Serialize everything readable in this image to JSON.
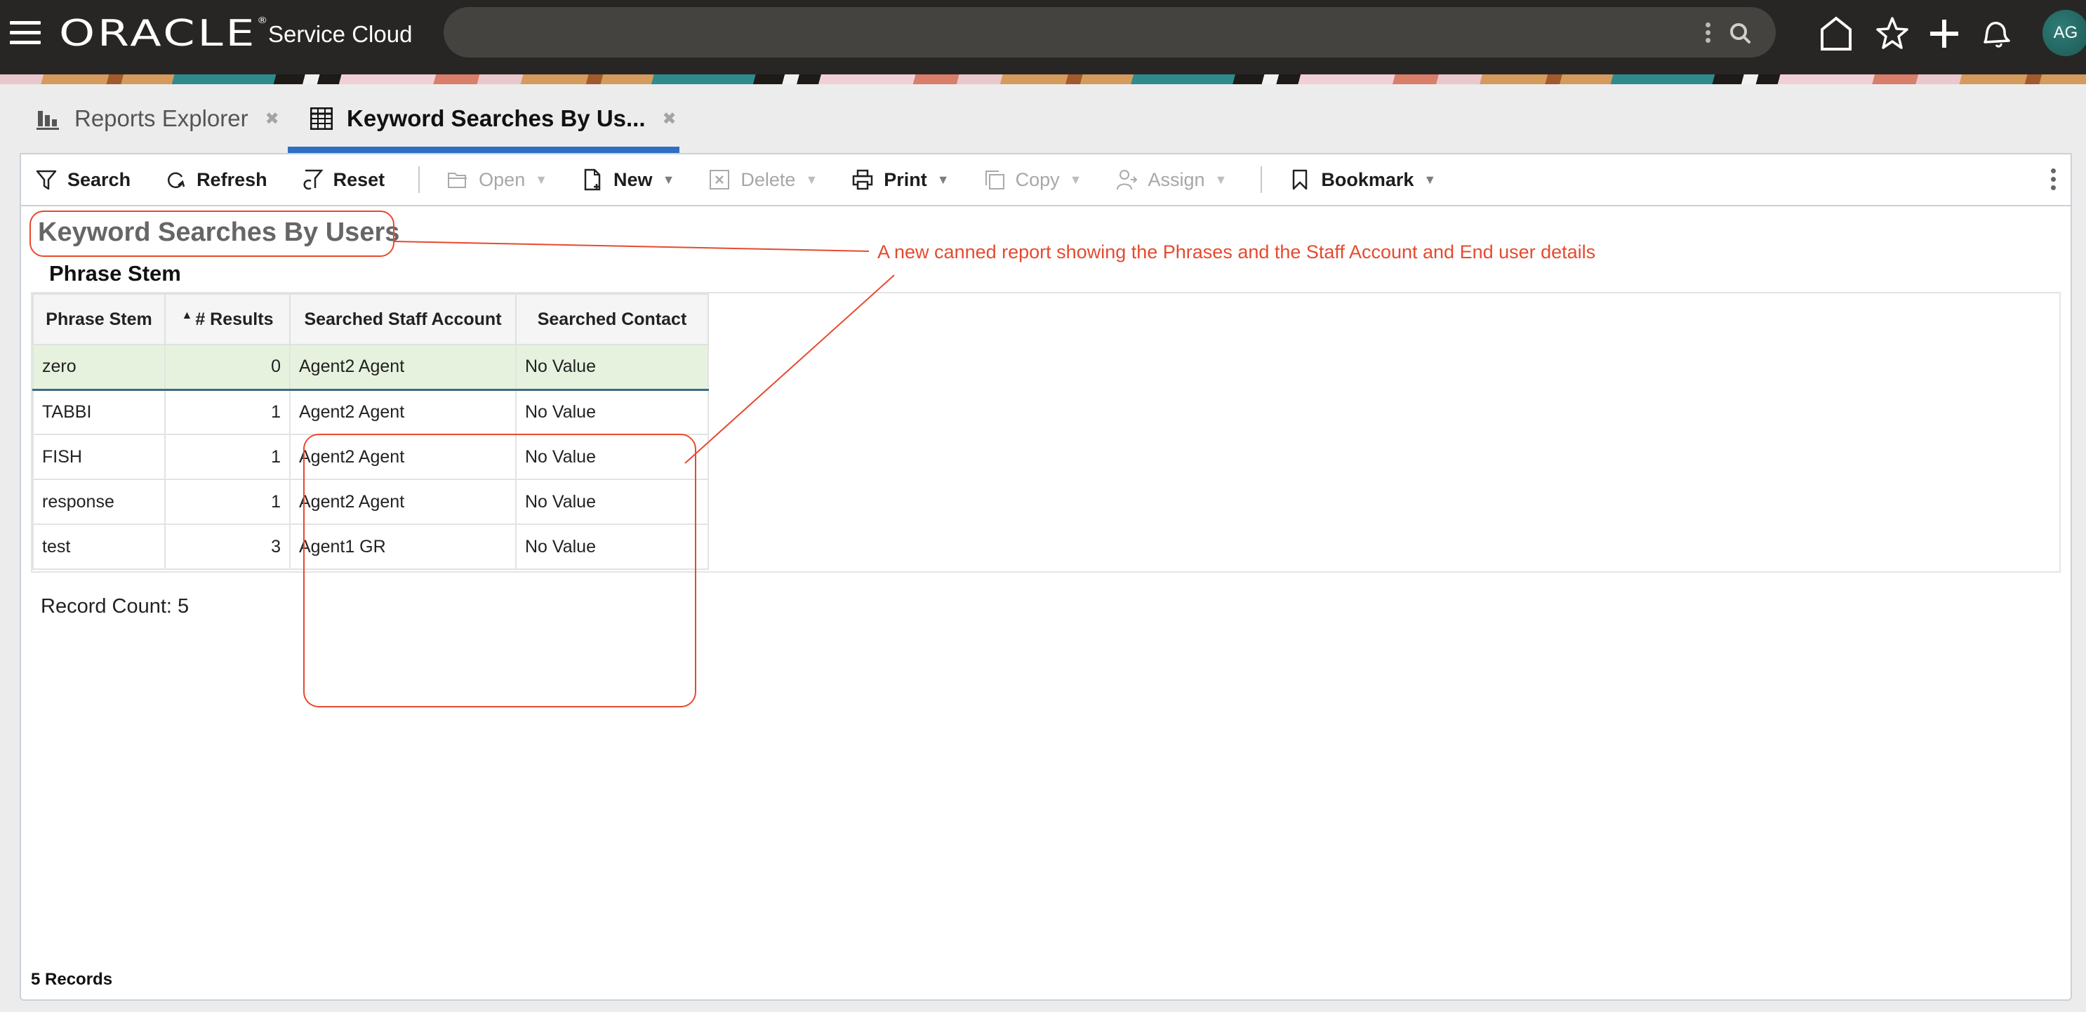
{
  "header": {
    "brand": "ORACLE",
    "product": "Service Cloud",
    "avatar_initials": "AG",
    "icons": [
      "menu-icon",
      "search-icon",
      "home-icon",
      "star-icon",
      "plus-icon",
      "bell-icon"
    ]
  },
  "tabs": [
    {
      "label": "Reports Explorer",
      "icon": "bar-chart-icon",
      "active": false
    },
    {
      "label": "Keyword Searches By Us...",
      "icon": "table-grid-icon",
      "active": true
    }
  ],
  "toolbar": {
    "search": "Search",
    "refresh": "Refresh",
    "reset": "Reset",
    "open": "Open",
    "new": "New",
    "delete": "Delete",
    "print": "Print",
    "copy": "Copy",
    "assign": "Assign",
    "bookmark": "Bookmark"
  },
  "report": {
    "title": "Keyword Searches By Users",
    "subtitle": "Phrase Stem",
    "columns": [
      "Phrase Stem",
      "# Results",
      "Searched Staff Account",
      "Searched Contact"
    ],
    "sort_indicator": "▲",
    "rows": [
      {
        "phrase": "zero",
        "results": "0",
        "staff": "Agent2 Agent",
        "contact": "No Value"
      },
      {
        "phrase": "TABBI",
        "results": "1",
        "staff": "Agent2 Agent",
        "contact": "No Value"
      },
      {
        "phrase": "FISH",
        "results": "1",
        "staff": "Agent2 Agent",
        "contact": "No Value"
      },
      {
        "phrase": "response",
        "results": "1",
        "staff": "Agent2 Agent",
        "contact": "No Value"
      },
      {
        "phrase": "test",
        "results": "3",
        "staff": "Agent1 GR",
        "contact": "No Value"
      }
    ],
    "record_count": "Record Count: 5",
    "footer": "5 Records"
  },
  "annotation": {
    "text": "A new canned report showing the Phrases and the Staff Account and End user details",
    "color": "#e64a2e"
  },
  "colors": {
    "topbar": "#272624",
    "tab_accent": "#2f6fc2",
    "selected_row": "#e6f2de"
  }
}
